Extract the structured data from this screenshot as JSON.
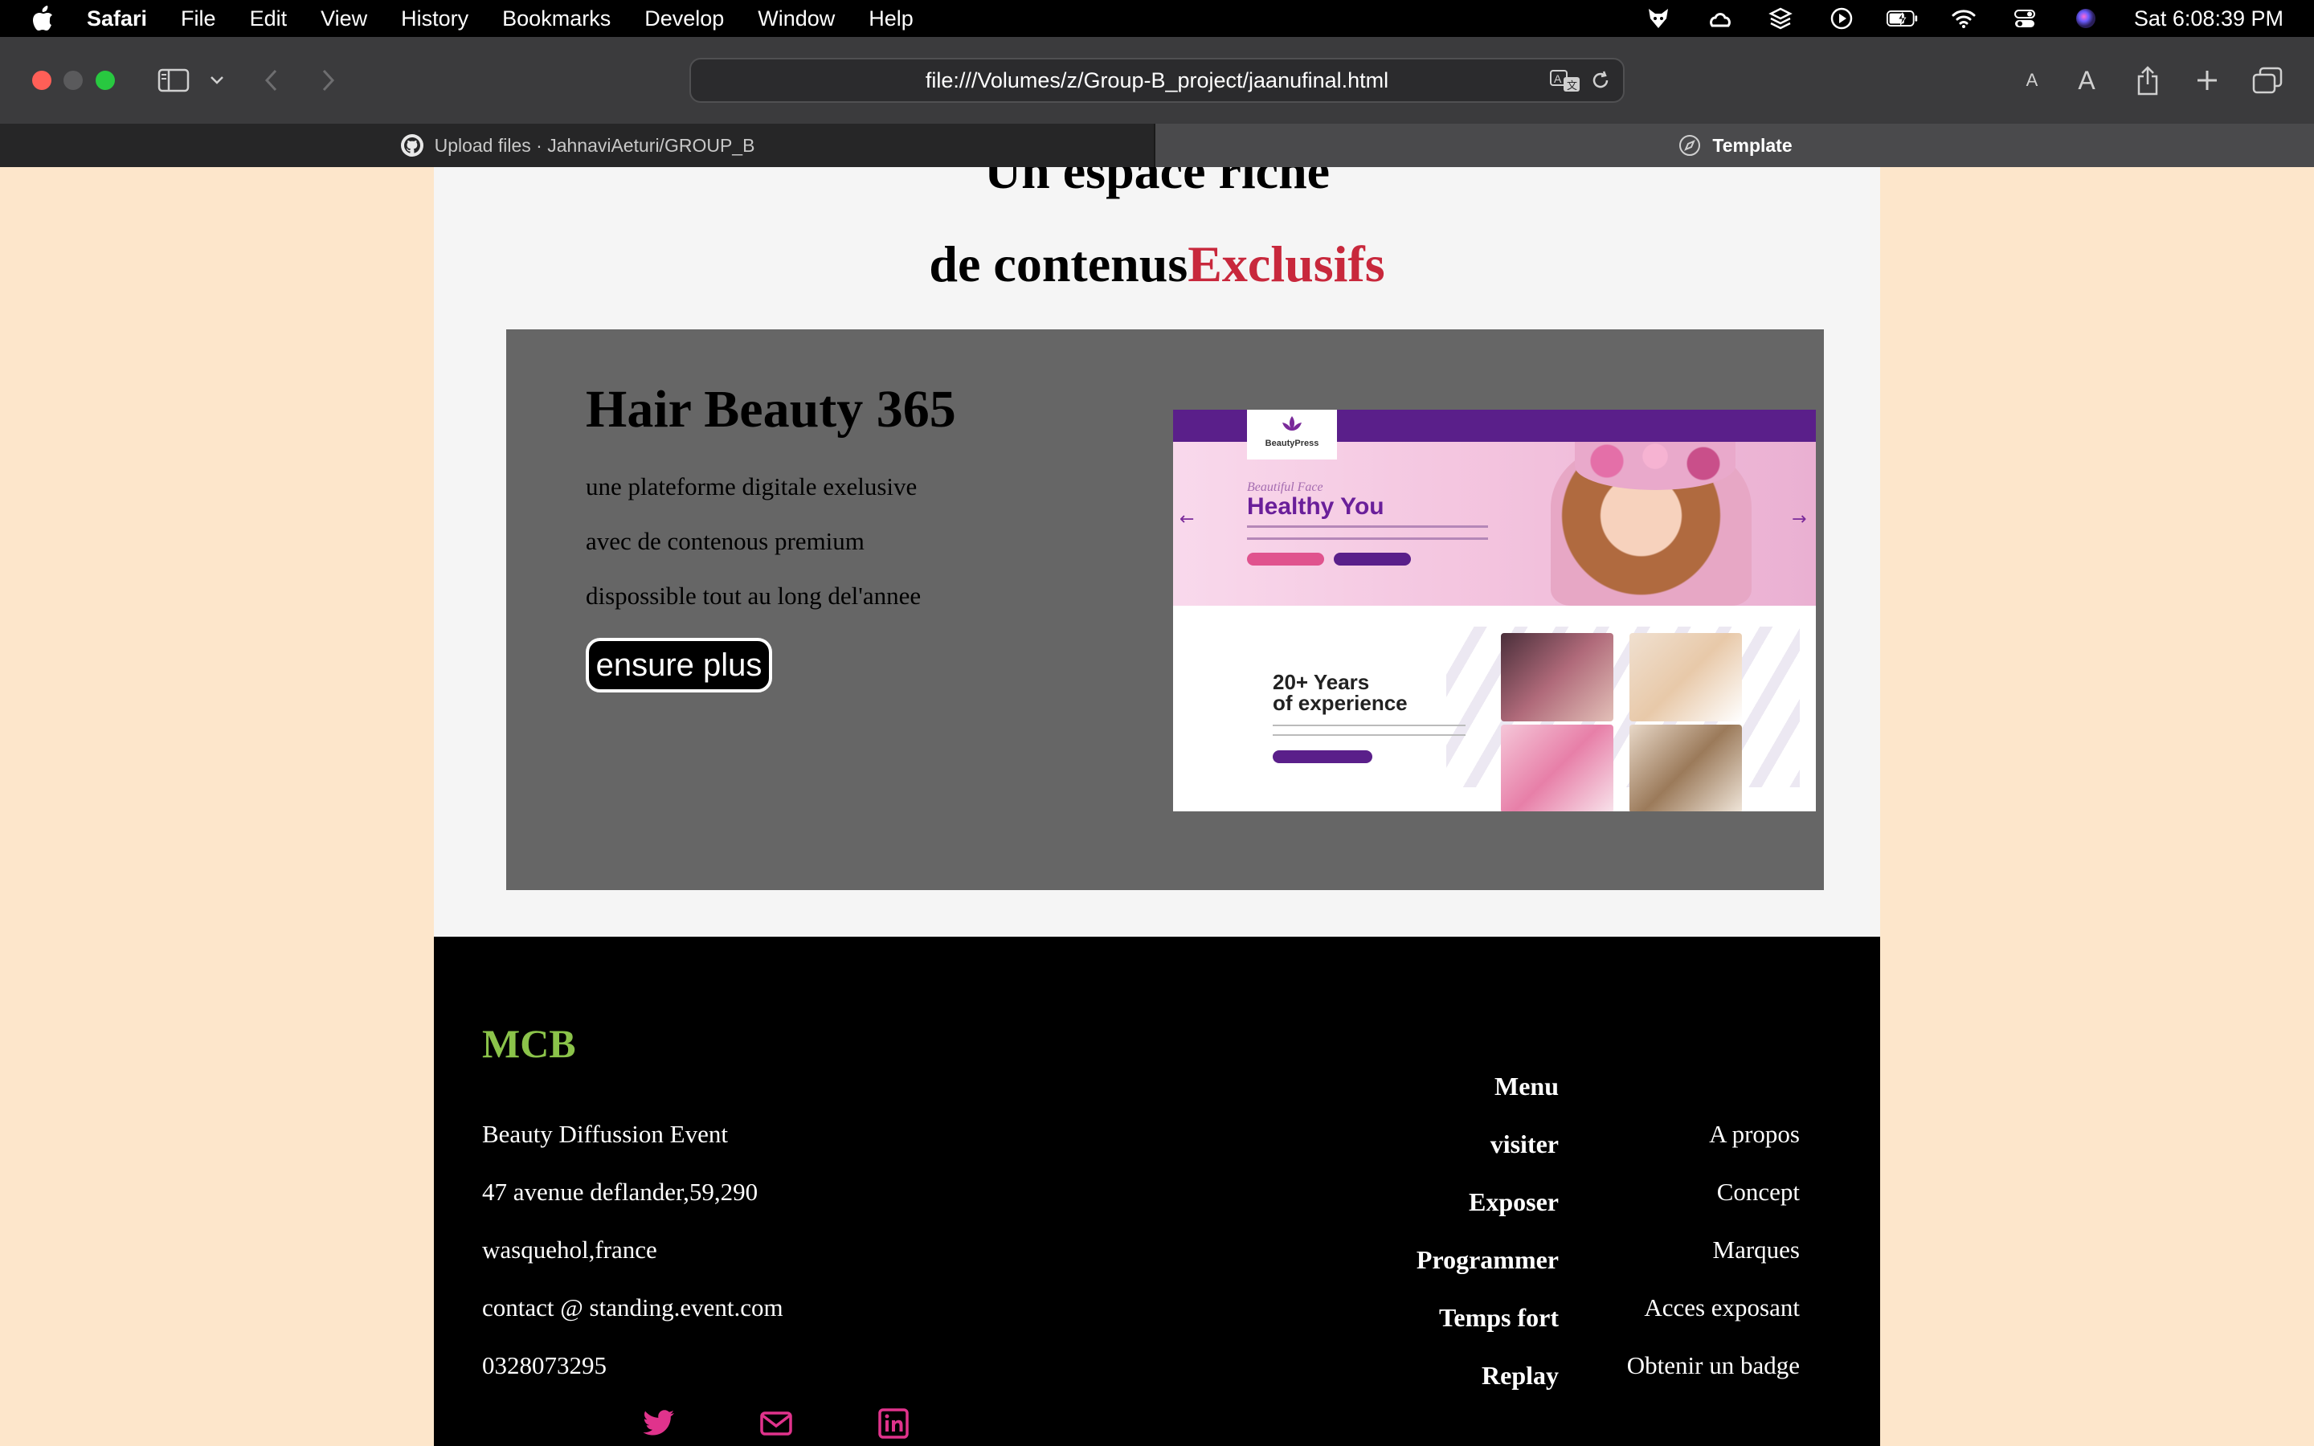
{
  "menubar": {
    "app": "Safari",
    "items": [
      "File",
      "Edit",
      "View",
      "History",
      "Bookmarks",
      "Develop",
      "Window",
      "Help"
    ],
    "clock": "Sat 6:08:39 PM"
  },
  "toolbar": {
    "url": "file:///Volumes/z/Group-B_project/jaanufinal.html"
  },
  "tabs": [
    {
      "label": "Upload files · JahnaviAeturi/GROUP_B",
      "icon": "github-icon"
    },
    {
      "label": "Template",
      "icon": "compass-icon"
    }
  ],
  "hero": {
    "line1": "Un espace riche",
    "line2_prefix": "de contenus",
    "line2_accent": "Exclusifs",
    "accent_color": "#c8283c"
  },
  "feature": {
    "title": "Hair Beauty 365",
    "lines": [
      "une plateforme digitale exelusive",
      "avec de contenous premium",
      "dispossible tout au long del'annee"
    ],
    "button": "ensure plus",
    "thumbnail": {
      "logo": "BeautyPress",
      "script": "Beautiful Face",
      "headline": "Healthy You",
      "years_line1": "20+ Years",
      "years_line2": "of experience"
    }
  },
  "footer": {
    "brand": "MCB",
    "brand_color": "#8bc34a",
    "address": [
      "Beauty Diffussion Event",
      "47 avenue deflander,59,290",
      "wasquehol,france",
      "contact @ standing.event.com",
      "0328073295"
    ],
    "menu_heading": "Menu",
    "menu_items": [
      "visiter",
      "Exposer",
      "Programmer",
      "Temps fort",
      "Replay"
    ],
    "links": [
      "A propos",
      "Concept",
      "Marques",
      "Acces exposant",
      "Obtenir un badge"
    ],
    "social": [
      "twitter-icon",
      "mail-icon",
      "linkedin-icon"
    ],
    "social_color": "#e0338c"
  }
}
